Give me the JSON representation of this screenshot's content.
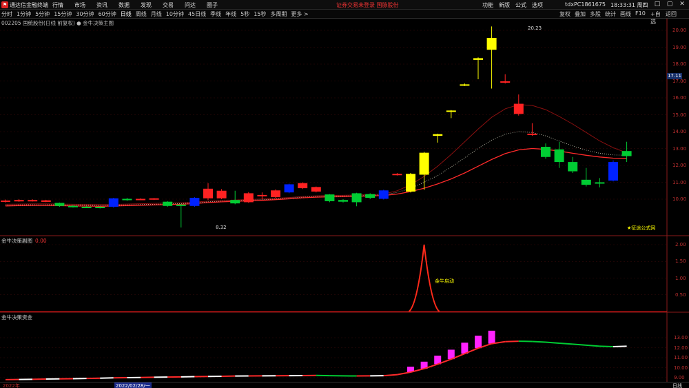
{
  "titlebar": {
    "app_name": "通达信金融终端",
    "menu": [
      "行情",
      "市场",
      "资讯",
      "数据",
      "发现",
      "交易",
      "问达",
      "圈子"
    ],
    "center_text": "证券交易未登录  国脉股份",
    "right_menu": [
      "功能",
      "新版",
      "公式",
      "选项"
    ],
    "user": "tdxPC1861675",
    "clock": "18:33:31 周四",
    "controls": [
      "–",
      "□",
      "▢",
      "✕"
    ]
  },
  "toolbar": {
    "periods": [
      "分时",
      "1分钟",
      "5分钟",
      "15分钟",
      "30分钟",
      "60分钟",
      "日线",
      "周线",
      "月线",
      "10分钟",
      "45日线",
      "季线",
      "年线",
      "5秒",
      "15秒",
      "多周期",
      "更多 >"
    ],
    "active_period": "日线",
    "right": [
      "复权",
      "叠加",
      "多股",
      "统计",
      "画线",
      "F10",
      "+自选",
      "返回"
    ]
  },
  "main_chart": {
    "stock_info": "002205 国统股份(日线 前复权)  ●  金牛决策主图",
    "y_ticks": [
      "20.00",
      "19.00",
      "18.00",
      "17.00",
      "16.00",
      "15.00",
      "14.00",
      "13.00",
      "12.00",
      "11.00",
      "10.00"
    ],
    "current_price": "17.11",
    "high_label": "20.23",
    "low_label": "8.32",
    "note": "★征途公式网"
  },
  "sub1": {
    "title": "金牛决策副图",
    "value": "0.00",
    "y_ticks": [
      "2.00",
      "1.50",
      "1.00",
      "0.50"
    ],
    "signal_label": "金牛启动"
  },
  "sub2": {
    "title": "金牛决策资金",
    "y_ticks": [
      "13.00",
      "12.00",
      "11.00",
      "10.00",
      "9.00"
    ]
  },
  "bottom": {
    "year": "2022年",
    "date": "2022/02/28/一",
    "period": "日线"
  },
  "chart_data": {
    "type": "candlestick",
    "candles": [
      {
        "o": 9.85,
        "c": 9.92,
        "h": 9.98,
        "l": 9.8,
        "color": "red"
      },
      {
        "o": 9.88,
        "c": 9.95,
        "h": 10.0,
        "l": 9.84,
        "color": "red"
      },
      {
        "o": 9.9,
        "c": 9.95,
        "h": 9.99,
        "l": 9.86,
        "color": "red"
      },
      {
        "o": 9.84,
        "c": 9.93,
        "h": 9.96,
        "l": 9.82,
        "color": "red"
      },
      {
        "o": 9.78,
        "c": 9.6,
        "h": 9.8,
        "l": 9.55,
        "color": "green"
      },
      {
        "o": 9.6,
        "c": 9.55,
        "h": 9.65,
        "l": 9.5,
        "color": "green"
      },
      {
        "o": 9.55,
        "c": 9.52,
        "h": 9.6,
        "l": 9.48,
        "color": "green"
      },
      {
        "o": 9.55,
        "c": 9.5,
        "h": 9.58,
        "l": 9.45,
        "color": "green"
      },
      {
        "o": 9.55,
        "c": 10.05,
        "h": 10.08,
        "l": 9.5,
        "color": "blue"
      },
      {
        "o": 10.02,
        "c": 9.95,
        "h": 10.08,
        "l": 9.9,
        "color": "green"
      },
      {
        "o": 9.98,
        "c": 10.02,
        "h": 10.05,
        "l": 9.94,
        "color": "red"
      },
      {
        "o": 9.98,
        "c": 10.05,
        "h": 10.07,
        "l": 9.95,
        "color": "red"
      },
      {
        "o": 9.85,
        "c": 9.6,
        "h": 9.88,
        "l": 9.55,
        "color": "green"
      },
      {
        "o": 9.68,
        "c": 9.62,
        "h": 9.72,
        "l": 8.32,
        "color": "green"
      },
      {
        "o": 9.6,
        "c": 10.08,
        "h": 10.12,
        "l": 9.55,
        "color": "blue"
      },
      {
        "o": 10.05,
        "c": 10.62,
        "h": 10.95,
        "l": 9.95,
        "color": "red"
      },
      {
        "o": 10.05,
        "c": 10.5,
        "h": 10.6,
        "l": 10.0,
        "color": "red"
      },
      {
        "o": 9.95,
        "c": 9.75,
        "h": 10.5,
        "l": 9.7,
        "color": "green"
      },
      {
        "o": 9.82,
        "c": 10.35,
        "h": 10.42,
        "l": 9.78,
        "color": "red"
      },
      {
        "o": 10.18,
        "c": 10.25,
        "h": 10.4,
        "l": 10.0,
        "color": "red"
      },
      {
        "o": 10.12,
        "c": 10.52,
        "h": 10.58,
        "l": 10.05,
        "color": "red"
      },
      {
        "o": 10.4,
        "c": 10.88,
        "h": 10.92,
        "l": 10.35,
        "color": "blue"
      },
      {
        "o": 10.65,
        "c": 10.95,
        "h": 11.0,
        "l": 10.6,
        "color": "red"
      },
      {
        "o": 10.45,
        "c": 10.72,
        "h": 10.75,
        "l": 10.4,
        "color": "red"
      },
      {
        "o": 10.28,
        "c": 9.88,
        "h": 10.3,
        "l": 9.82,
        "color": "green"
      },
      {
        "o": 9.95,
        "c": 9.85,
        "h": 10.0,
        "l": 9.8,
        "color": "green"
      },
      {
        "o": 9.82,
        "c": 10.35,
        "h": 10.38,
        "l": 9.58,
        "color": "green"
      },
      {
        "o": 10.3,
        "c": 10.08,
        "h": 10.35,
        "l": 10.0,
        "color": "green"
      },
      {
        "o": 10.02,
        "c": 10.52,
        "h": 10.56,
        "l": 9.98,
        "color": "blue"
      },
      {
        "o": 11.45,
        "c": 11.5,
        "h": 11.55,
        "l": 11.4,
        "color": "red"
      },
      {
        "o": 10.45,
        "c": 11.5,
        "h": 11.55,
        "l": 10.4,
        "color": "yellow"
      },
      {
        "o": 11.45,
        "c": 12.75,
        "h": 12.8,
        "l": 10.55,
        "color": "yellow"
      },
      {
        "o": 13.75,
        "c": 13.85,
        "h": 13.88,
        "l": 13.35,
        "color": "yellow"
      },
      {
        "o": 15.2,
        "c": 15.25,
        "h": 15.28,
        "l": 14.8,
        "color": "yellow"
      },
      {
        "o": 16.75,
        "c": 16.8,
        "h": 16.85,
        "l": 16.7,
        "color": "yellow"
      },
      {
        "o": 18.25,
        "c": 18.35,
        "h": 18.4,
        "l": 17.1,
        "color": "yellow"
      },
      {
        "o": 18.85,
        "c": 19.55,
        "h": 20.23,
        "l": 16.55,
        "color": "yellow"
      },
      {
        "o": 16.95,
        "c": 16.98,
        "h": 17.4,
        "l": 16.85,
        "color": "red"
      },
      {
        "o": 15.05,
        "c": 15.65,
        "h": 16.2,
        "l": 14.95,
        "color": "red"
      },
      {
        "o": 13.85,
        "c": 13.88,
        "h": 14.5,
        "l": 13.75,
        "color": "red"
      },
      {
        "o": 13.1,
        "c": 12.5,
        "h": 13.3,
        "l": 12.4,
        "color": "green"
      },
      {
        "o": 12.95,
        "c": 12.2,
        "h": 13.4,
        "l": 11.85,
        "color": "green"
      },
      {
        "o": 12.2,
        "c": 11.65,
        "h": 12.5,
        "l": 11.55,
        "color": "green"
      },
      {
        "o": 11.15,
        "c": 10.85,
        "h": 11.85,
        "l": 10.75,
        "color": "green"
      },
      {
        "o": 11.0,
        "c": 10.95,
        "h": 11.25,
        "l": 10.7,
        "color": "green"
      },
      {
        "o": 11.1,
        "c": 12.2,
        "h": 12.3,
        "l": 11.05,
        "color": "blue"
      },
      {
        "o": 12.55,
        "c": 12.85,
        "h": 13.4,
        "l": 12.2,
        "color": "green"
      }
    ],
    "ma_red": [
      9.6,
      9.62,
      9.63,
      9.63,
      9.62,
      9.6,
      9.59,
      9.58,
      9.6,
      9.62,
      9.64,
      9.66,
      9.68,
      9.7,
      9.74,
      9.8,
      9.84,
      9.87,
      9.9,
      9.93,
      9.97,
      10.02,
      10.08,
      10.12,
      10.14,
      10.15,
      10.17,
      10.19,
      10.22,
      10.3,
      10.45,
      10.65,
      10.9,
      11.2,
      11.55,
      11.95,
      12.35,
      12.7,
      12.92,
      13.0,
      12.95,
      12.85,
      12.72,
      12.6,
      12.5,
      12.43,
      12.42
    ],
    "ma_dark": [
      9.7,
      9.71,
      9.72,
      9.72,
      9.71,
      9.7,
      9.69,
      9.68,
      9.69,
      9.71,
      9.73,
      9.75,
      9.77,
      9.79,
      9.83,
      9.88,
      9.92,
      9.95,
      9.98,
      10.01,
      10.05,
      10.1,
      10.16,
      10.2,
      10.22,
      10.23,
      10.25,
      10.27,
      10.3,
      10.5,
      10.85,
      11.35,
      11.95,
      12.65,
      13.4,
      14.15,
      14.85,
      15.35,
      15.6,
      15.55,
      15.3,
      14.9,
      14.45,
      13.95,
      13.45,
      13.05,
      12.75
    ],
    "ma_dot": [
      9.65,
      9.66,
      9.67,
      9.67,
      9.66,
      9.65,
      9.64,
      9.63,
      9.64,
      9.66,
      9.68,
      9.7,
      9.72,
      9.74,
      9.78,
      9.84,
      9.88,
      9.91,
      9.94,
      9.97,
      10.01,
      10.06,
      10.12,
      10.16,
      10.18,
      10.19,
      10.21,
      10.23,
      10.26,
      10.4,
      10.65,
      11.0,
      11.4,
      11.9,
      12.45,
      13.0,
      13.5,
      13.85,
      14.0,
      13.95,
      13.75,
      13.45,
      13.15,
      12.9,
      12.72,
      12.62,
      12.6
    ],
    "sub1_signal": {
      "peak_index": 31,
      "value": 2.0
    },
    "sub2_bars": [
      10.1,
      10.6,
      11.2,
      11.8,
      12.5,
      13.2,
      13.7
    ],
    "sub2_line": [
      8.8,
      8.82,
      8.84,
      8.86,
      8.88,
      8.9,
      8.92,
      8.95,
      8.98,
      9.0,
      9.02,
      9.04,
      9.06,
      9.08,
      9.1,
      9.12,
      9.14,
      9.16,
      9.17,
      9.18,
      9.19,
      9.2,
      9.21,
      9.22,
      9.2,
      9.18,
      9.17,
      9.18,
      9.2,
      9.3,
      9.55,
      9.9,
      10.35,
      10.85,
      11.4,
      11.95,
      12.4,
      12.6,
      12.65,
      12.62,
      12.55,
      12.45,
      12.35,
      12.25,
      12.15,
      12.1,
      12.15
    ]
  }
}
